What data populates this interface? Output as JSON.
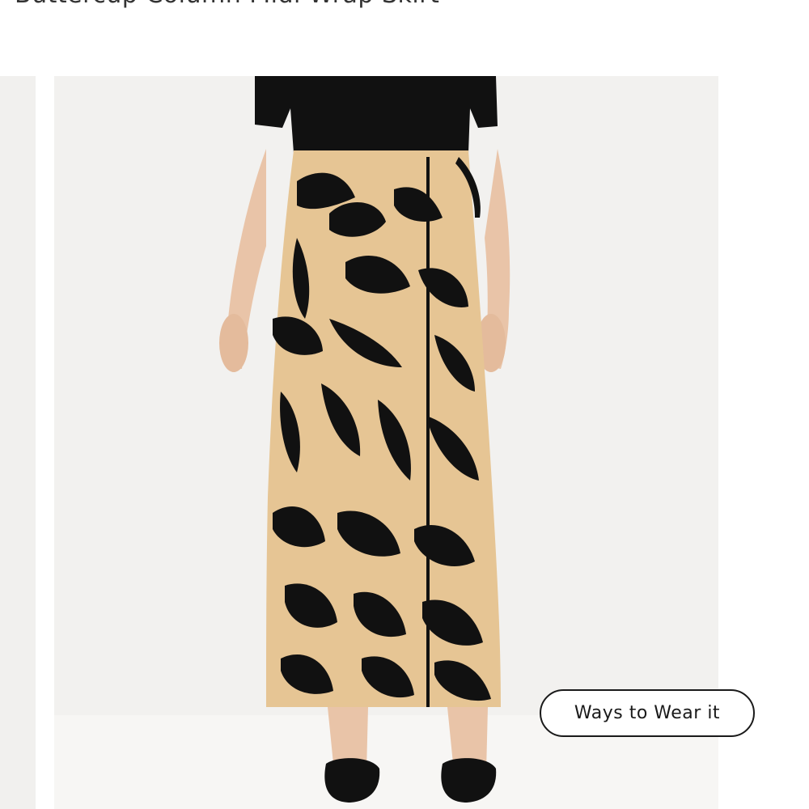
{
  "product": {
    "title": "Buttercup Column Midi Wrap Skirt"
  },
  "gallery": {
    "main_image_alt": "Model wearing Buttercup Column Midi Wrap Skirt with black top and black flats",
    "ways_to_wear_label": "Ways to Wear it"
  },
  "colors": {
    "image_background": "#f2f1ef",
    "skirt_base": "#e6c594",
    "print_color": "#111111",
    "skin": "#e9c4a8",
    "button_border": "#1a1a1a"
  },
  "icons": [
    "product-photo-icon"
  ]
}
